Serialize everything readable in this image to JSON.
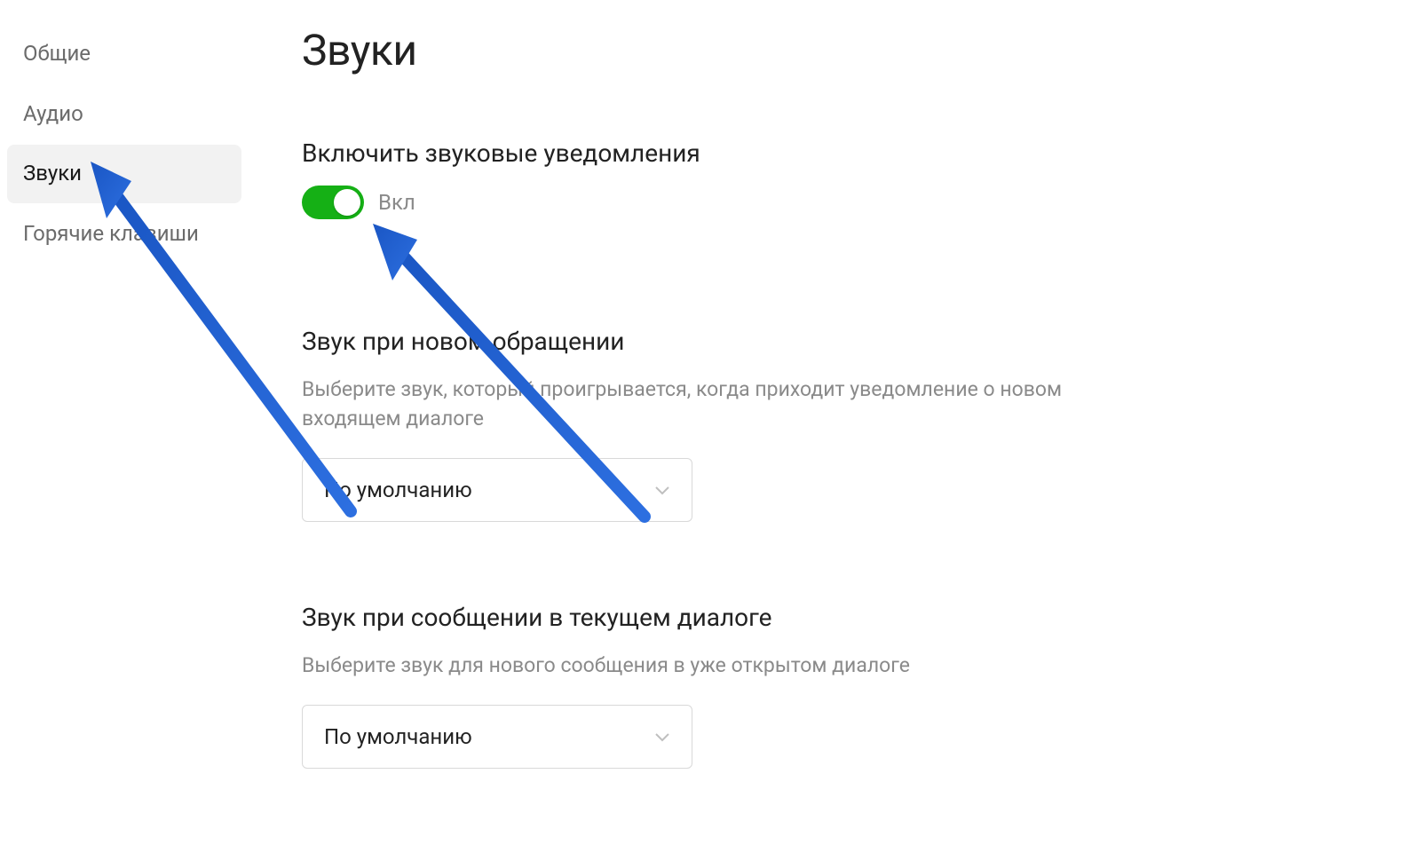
{
  "sidebar": {
    "items": [
      {
        "label": "Общие",
        "active": false
      },
      {
        "label": "Аудио",
        "active": false
      },
      {
        "label": "Звуки",
        "active": true
      },
      {
        "label": "Горячие клавиши",
        "active": false
      }
    ]
  },
  "page": {
    "title": "Звуки"
  },
  "enable_section": {
    "title": "Включить звуковые уведомления",
    "toggle_state": "on",
    "toggle_label": "Вкл"
  },
  "new_request_section": {
    "title": "Звук при новом обращении",
    "description": "Выберите звук, который проигрывается, когда приходит уведомление о новом входящем диалоге",
    "select_value": "По умолчанию"
  },
  "current_dialog_section": {
    "title": "Звук при сообщении в текущем диалоге",
    "description": "Выберите звук для нового сообщения в уже открытом диалоге",
    "select_value": "По умолчанию"
  },
  "annotation_color": "#1a56c4"
}
